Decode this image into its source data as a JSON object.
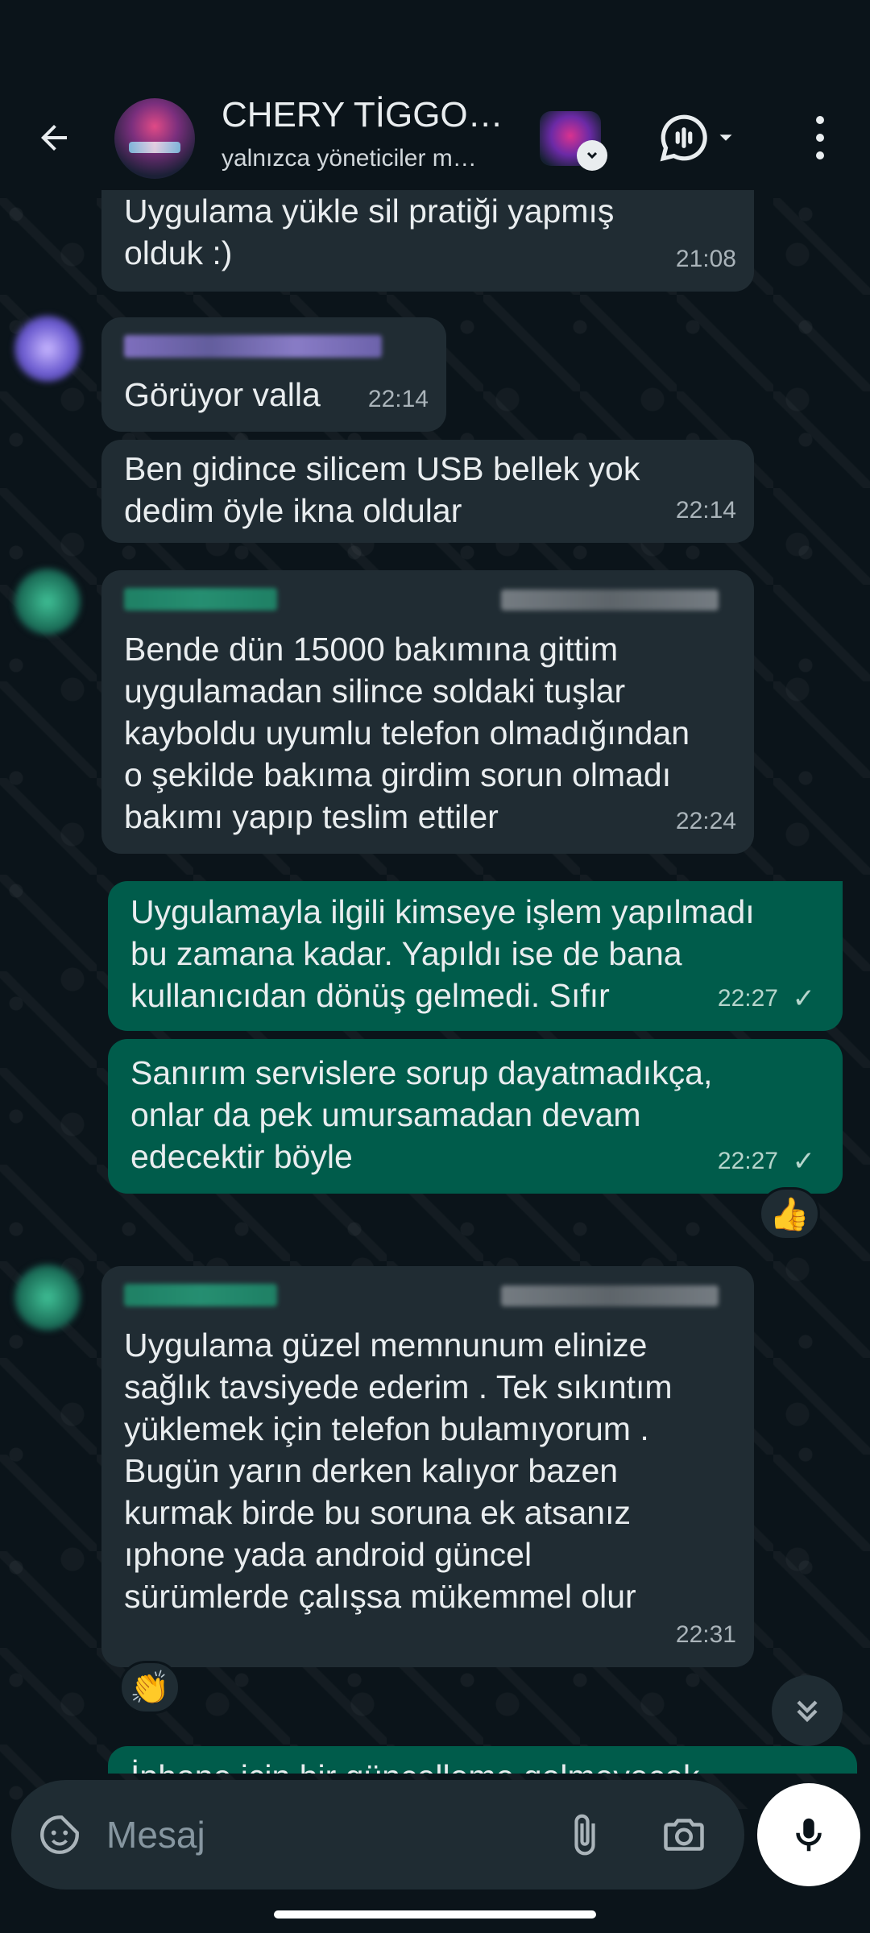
{
  "header": {
    "title": "CHERY TİGGO…",
    "subtitle": "yalnızca yöneticiler m…"
  },
  "messages": [
    {
      "text": "Uygulama yükle sil pratiği yapmış\nolduk :)",
      "time": "21:08",
      "direction": "in"
    },
    {
      "text": "Görüyor valla",
      "time": "22:14",
      "direction": "in"
    },
    {
      "text": "Ben gidince silicem USB bellek yok\ndedim öyle ikna oldular",
      "time": "22:14",
      "direction": "in"
    },
    {
      "text": "Bende dün 15000 bakımına gittim\nuygulamadan silince soldaki tuşlar\nkayboldu uyumlu telefon olmadığından\no şekilde bakıma girdim sorun olmadı\nbakımı yapıp teslim ettiler",
      "time": "22:24",
      "direction": "in"
    },
    {
      "text": "Uygulamayla ilgili kimseye işlem yapılmadı\nbu zamana kadar. Yapıldı ise de bana\nkullanıcıdan dönüş gelmedi. Sıfır",
      "time": "22:27",
      "direction": "out"
    },
    {
      "text": "Sanırım servislere sorup dayatmadıkça,\nonlar da pek umursamadan devam\nedecektir böyle",
      "time": "22:27",
      "direction": "out",
      "reaction": "👍"
    },
    {
      "text": "Uygulama güzel memnunum elinize\nsağlık tavsiyede ederim . Tek sıkıntım\nyüklemek için telefon bulamıyorum .\nBugün yarın derken kalıyor bazen\nkurmak birde bu soruna ek atsanız\nıphone yada  android  güncel\nsürümlerde çalışsa mükemmel olur",
      "time": "22:31",
      "direction": "in",
      "reaction": "👏"
    },
    {
      "text": "İphone için bir güncelleme gelmeyecek",
      "direction": "out"
    }
  ],
  "composer": {
    "placeholder": "Mesaj"
  },
  "icons": {
    "back": "arrow-left-icon",
    "call": "voice-chat-icon",
    "menu": "more-vert-icon",
    "emoji": "sticker-emoji-icon",
    "attach": "paperclip-icon",
    "camera": "camera-icon",
    "mic": "microphone-icon",
    "scroll": "double-chevron-down-icon"
  },
  "colors": {
    "background": "#0b141a",
    "incoming_bubble": "#202c33",
    "outgoing_bubble": "#005c4b",
    "tick": "#b6d5cc"
  }
}
